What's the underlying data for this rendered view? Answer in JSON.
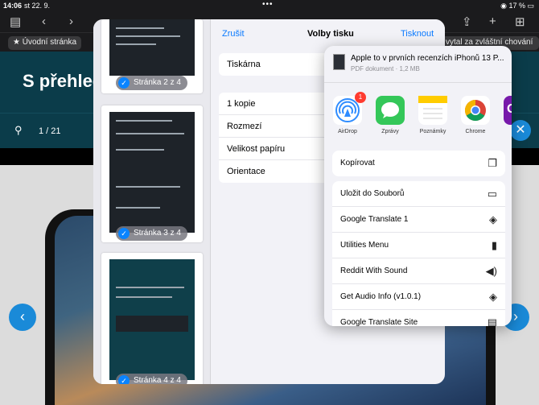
{
  "status_bar": {
    "time": "14:06",
    "date": "st 22. 9.",
    "battery": "17 %"
  },
  "browser": {
    "bookmarks": [
      "Úvodní stránka",
      "vytal za zvláštní chování"
    ],
    "icons": [
      "sidebar-icon",
      "back-icon",
      "forward-icon",
      "share-icon",
      "new-tab-icon",
      "tabs-icon"
    ]
  },
  "page": {
    "title": "S přehled",
    "pdf_page": "1 / 21"
  },
  "print_options": {
    "cancel": "Zrušit",
    "title": "Volby tisku",
    "print": "Tisknout",
    "printer_label": "Tiskárna",
    "rows": [
      "1 kopie",
      "Rozmezí",
      "Velikost papíru",
      "Orientace"
    ],
    "pages": [
      "Stránka 2 z 4",
      "Stránka 3 z 4",
      "Stránka 4 z 4"
    ]
  },
  "share_sheet": {
    "file_name": "Apple to v prvních recenzích iPhonů 13 P...",
    "file_meta": "PDF dokument · 1,2 MB",
    "apps": [
      {
        "label": "AirDrop",
        "icon": "airdrop-icon",
        "badge": "1"
      },
      {
        "label": "Zprávy",
        "icon": "messages-icon"
      },
      {
        "label": "Poznámky",
        "icon": "notes-icon"
      },
      {
        "label": "Chrome",
        "icon": "chrome-icon"
      },
      {
        "label": "O",
        "icon": "onenote-icon"
      }
    ],
    "copy": "Kopírovat",
    "actions": [
      {
        "label": "Uložit do Souborů",
        "icon": "folder-icon"
      },
      {
        "label": "Google Translate 1",
        "icon": "layers-icon"
      },
      {
        "label": "Utilities Menu",
        "icon": "clipboard-icon"
      },
      {
        "label": "Reddit With Sound",
        "icon": "speaker-icon"
      },
      {
        "label": "Get Audio Info (v1.0.1)",
        "icon": "layers-icon"
      },
      {
        "label": "Google Translate Site",
        "icon": "document-icon"
      }
    ]
  }
}
